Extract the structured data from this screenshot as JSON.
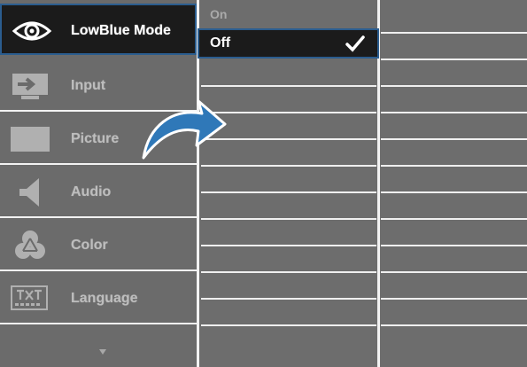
{
  "menu": {
    "items": [
      {
        "label": "LowBlue Mode",
        "icon": "eye-icon",
        "selected": true
      },
      {
        "label": "Input",
        "icon": "input-icon"
      },
      {
        "label": "Picture",
        "icon": "picture-icon"
      },
      {
        "label": "Audio",
        "icon": "speaker-icon"
      },
      {
        "label": "Color",
        "icon": "color-circles-icon"
      },
      {
        "label": "Language",
        "icon": "txt-language-icon"
      }
    ],
    "more_icon": "chevron-down-icon"
  },
  "submenu": {
    "options": [
      {
        "label": "On"
      },
      {
        "label": "Off",
        "selected": true,
        "icon": "check-icon"
      }
    ]
  },
  "overlay": {
    "icon": "curved-arrow-icon"
  },
  "colors": {
    "background": "#6d6d6d",
    "selected_bg": "#1b1b1b",
    "selected_border": "#2b5d8f",
    "divider": "#f2f2f2",
    "arrow": "#2f78b8"
  }
}
